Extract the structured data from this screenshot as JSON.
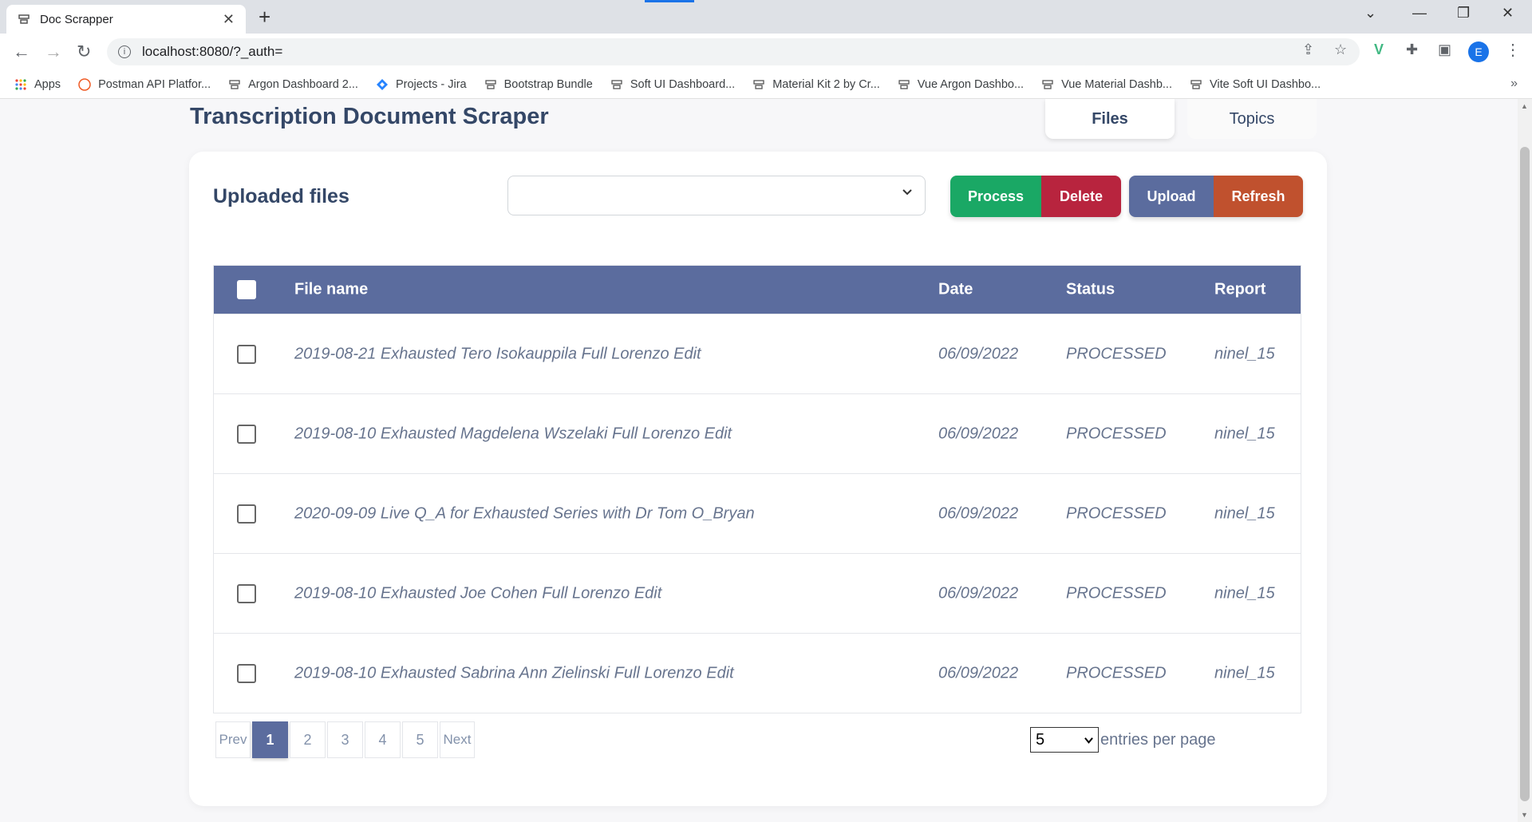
{
  "browser": {
    "tab_title": "Doc Scrapper",
    "url": "localhost:8080/?_auth=",
    "profile_initial": "E",
    "bookmarks": [
      {
        "label": "Apps",
        "icon": "apps-grid-icon"
      },
      {
        "label": "Postman API Platfor...",
        "icon": "postman-icon"
      },
      {
        "label": "Argon Dashboard 2...",
        "icon": "site-icon"
      },
      {
        "label": "Projects - Jira",
        "icon": "jira-icon"
      },
      {
        "label": "Bootstrap Bundle",
        "icon": "site-icon"
      },
      {
        "label": "Soft UI Dashboard...",
        "icon": "site-icon"
      },
      {
        "label": "Material Kit 2 by Cr...",
        "icon": "site-icon"
      },
      {
        "label": "Vue Argon Dashbo...",
        "icon": "site-icon"
      },
      {
        "label": "Vue Material Dashb...",
        "icon": "site-icon"
      },
      {
        "label": "Vite Soft UI Dashbo...",
        "icon": "site-icon"
      }
    ],
    "bookmarks_more": "»"
  },
  "page": {
    "title": "Transcription Document Scraper",
    "nav": [
      {
        "label": "Files",
        "active": true
      },
      {
        "label": "Topics",
        "active": false
      }
    ]
  },
  "card": {
    "title": "Uploaded files",
    "select_value": "",
    "buttons": {
      "process": "Process",
      "delete": "Delete",
      "upload": "Upload",
      "refresh": "Refresh"
    },
    "colors": {
      "process": "#1aa865",
      "delete": "#b8243e",
      "upload": "#5b6c9e",
      "refresh": "#c0512e",
      "header": "#5b6c9e"
    }
  },
  "table": {
    "headers": {
      "file_name": "File name",
      "date": "Date",
      "status": "Status",
      "report": "Report"
    },
    "rows": [
      {
        "file_name": "2019-08-21 Exhausted Tero Isokauppila Full Lorenzo Edit",
        "date": "06/09/2022",
        "status": "PROCESSED",
        "report": "ninel_15"
      },
      {
        "file_name": "2019-08-10 Exhausted Magdelena Wszelaki Full Lorenzo Edit",
        "date": "06/09/2022",
        "status": "PROCESSED",
        "report": "ninel_15"
      },
      {
        "file_name": "2020-09-09 Live Q_A for Exhausted Series with Dr Tom O_Bryan",
        "date": "06/09/2022",
        "status": "PROCESSED",
        "report": "ninel_15"
      },
      {
        "file_name": "2019-08-10 Exhausted Joe Cohen Full Lorenzo Edit",
        "date": "06/09/2022",
        "status": "PROCESSED",
        "report": "ninel_15"
      },
      {
        "file_name": "2019-08-10 Exhausted Sabrina Ann Zielinski Full Lorenzo Edit",
        "date": "06/09/2022",
        "status": "PROCESSED",
        "report": "ninel_15"
      }
    ]
  },
  "pagination": {
    "prev": "Prev",
    "next": "Next",
    "pages": [
      "1",
      "2",
      "3",
      "4",
      "5"
    ],
    "current": "1",
    "entries_value": "5",
    "entries_label": "entries per page"
  }
}
